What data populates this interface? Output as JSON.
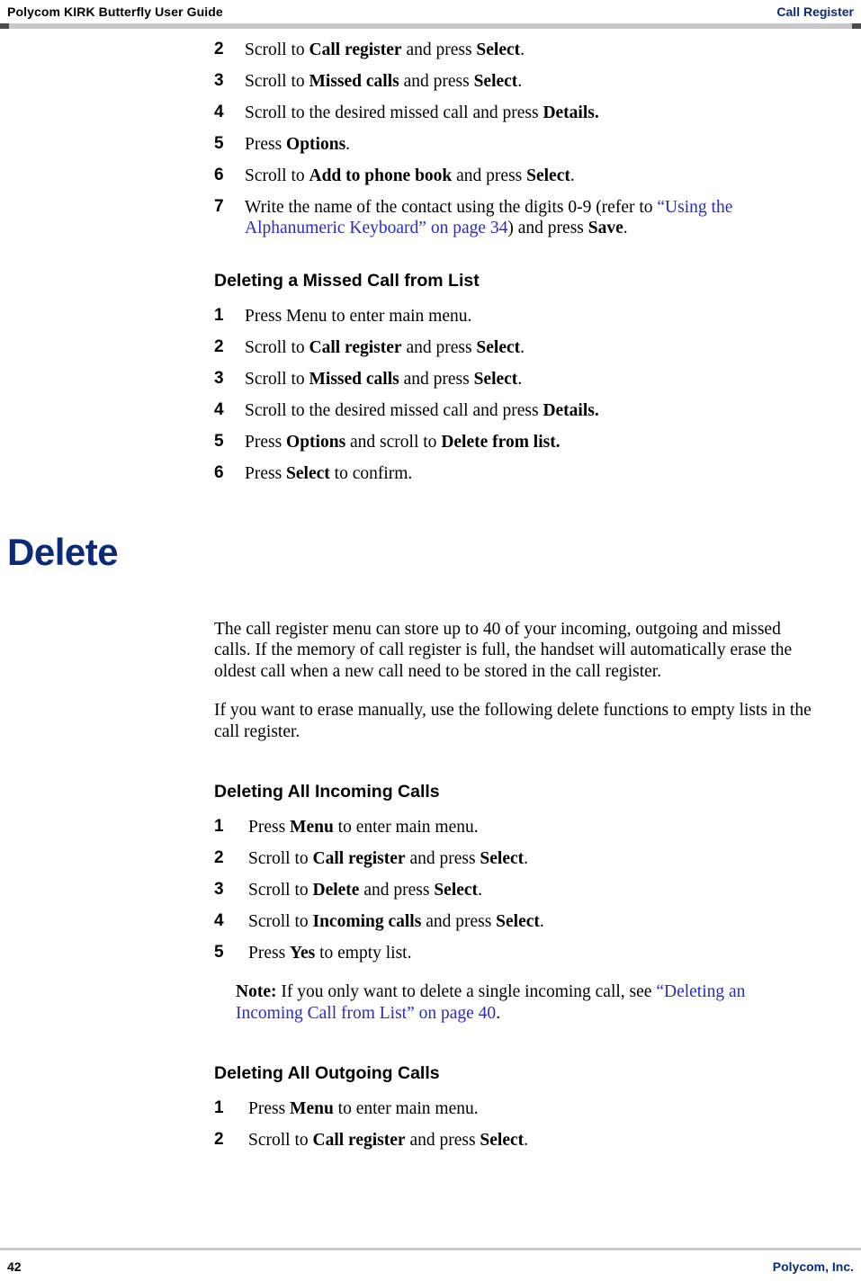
{
  "header": {
    "left": "Polycom KIRK Butterfly User Guide",
    "right": "Call Register"
  },
  "footer": {
    "page_number": "42",
    "company": "Polycom, Inc."
  },
  "sections": [
    {
      "id": "adding-missed-call-steps",
      "steps": [
        {
          "num": "2",
          "html": "Scroll to <b>Call register</b>  and press <b>Select</b>."
        },
        {
          "num": "3",
          "html": "Scroll to  <b>Missed calls</b> and press <b>Select</b>."
        },
        {
          "num": "4",
          "html": "Scroll to the desired missed call and press <b>Details.</b>"
        },
        {
          "num": "5",
          "html": "Press <b>Options</b>."
        },
        {
          "num": "6",
          "html": "Scroll to <b>Add to phone book</b> and press <b>Select</b>."
        },
        {
          "num": "7",
          "html": "Write the name of the contact using the digits 0-9 (refer to <span class=\"link\">“Using the Alphanumeric Keyboard” on page 34</span>) and press <b>Save</b>."
        }
      ]
    },
    {
      "id": "deleting-missed-call",
      "heading": "Deleting a Missed Call from List",
      "steps": [
        {
          "num": "1",
          "html": "Press Menu to enter main menu."
        },
        {
          "num": "2",
          "html": "Scroll to <b>Call register</b>  and press <b>Select</b>."
        },
        {
          "num": "3",
          "html": "Scroll to  <b>Missed calls</b> and press <b>Select</b>."
        },
        {
          "num": "4",
          "html": "Scroll to the desired missed call and press <b>Details.</b>"
        },
        {
          "num": "5",
          "html": "Press <b>Options</b> and scroll to <b>Delete from list.</b>"
        },
        {
          "num": "6",
          "html": "Press <b>Select</b> to confirm."
        }
      ]
    }
  ],
  "chapter": {
    "title": "Delete",
    "paragraphs": [
      "The call register menu can store up to 40 of your incoming, outgoing and missed calls. If the memory of call register is full, the handset will automatically erase the oldest call when a new call need to be stored in the call register.",
      "If you want to erase manually, use the following delete functions to empty lists in the call register."
    ]
  },
  "sections2": [
    {
      "id": "deleting-all-incoming",
      "heading": "Deleting All Incoming Calls",
      "steps": [
        {
          "num": "1",
          "html": "Press <b>Menu</b> to enter main menu."
        },
        {
          "num": "2",
          "html": "Scroll to <b>Call register</b>  and press <b>Select</b>."
        },
        {
          "num": "3",
          "html": "Scroll to <b>Delete</b> and press <b>Select</b>."
        },
        {
          "num": "4",
          "html": "Scroll to <b>Incoming calls</b> and press <b>Select</b>."
        },
        {
          "num": "5",
          "html": "Press <b>Yes</b> to empty list."
        }
      ],
      "note": "<b>Note:</b> If you only want to delete a single incoming call, see <span class=\"link\">“Deleting an Incoming Call from List” on page 40</span>."
    },
    {
      "id": "deleting-all-outgoing",
      "heading": "Deleting All Outgoing Calls",
      "steps": [
        {
          "num": "1",
          "html": "Press <b>Menu</b> to enter main menu."
        },
        {
          "num": "2",
          "html": "Scroll to <b>Call register</b>  and press <b>Select</b>."
        }
      ]
    }
  ]
}
